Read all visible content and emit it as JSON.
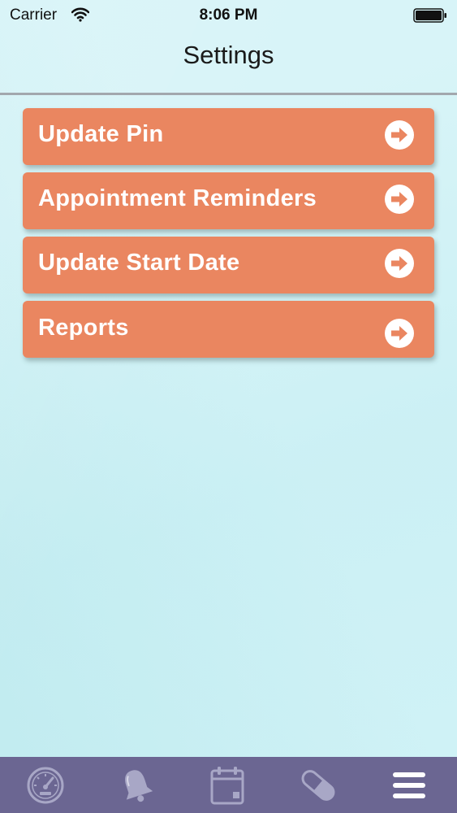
{
  "status_bar": {
    "carrier": "Carrier",
    "time": "8:06 PM"
  },
  "header": {
    "title": "Settings"
  },
  "menu": {
    "items": [
      {
        "label": "Update Pin",
        "icon": "arrow-right-circle-icon"
      },
      {
        "label": "Appointment Reminders",
        "icon": "arrow-right-circle-icon"
      },
      {
        "label": "Update Start Date",
        "icon": "arrow-right-circle-icon"
      },
      {
        "label": "Reports",
        "icon": "arrow-right-circle-icon"
      }
    ]
  },
  "tab_bar": {
    "tabs": [
      {
        "icon": "speedometer-icon"
      },
      {
        "icon": "bell-icon"
      },
      {
        "icon": "calendar-icon"
      },
      {
        "icon": "pill-icon"
      },
      {
        "icon": "hamburger-menu-icon",
        "selected": true
      }
    ]
  },
  "colors": {
    "background": "#d0f2f6",
    "button": "#ea8660",
    "button_text": "#ffffff",
    "tab_bar": "#6b6692",
    "tab_icon": "#a8a7c6",
    "tab_icon_selected": "#ffffff"
  }
}
